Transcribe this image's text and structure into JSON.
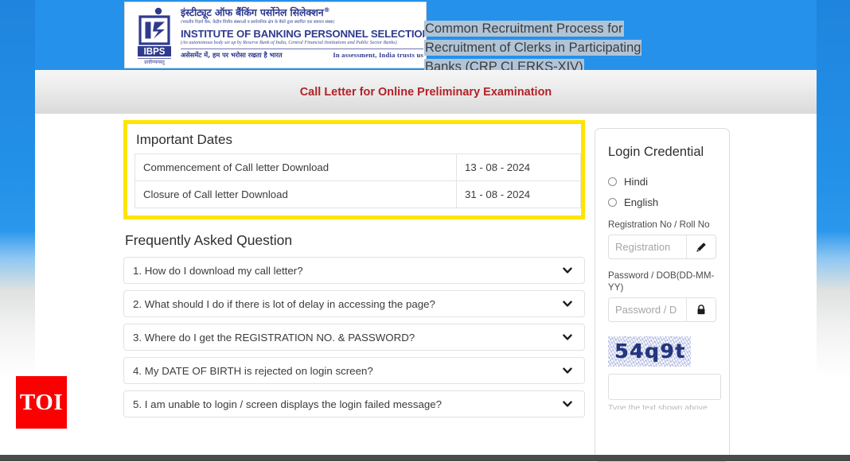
{
  "logo": {
    "hindi_title": "इंस्टीट्यूट ऑफ बैंकिंग पर्सोनेल सिलेक्शन",
    "registered_mark": "®",
    "hindi_subtitle": "(भारतीय रिज़र्व बैंक, केंद्रीय वित्तीय संस्थाओं व सार्वजनिक क्षेत्र के बैंकों द्वारा स्थापित एक स्वायत्त संस्था)",
    "english_title": "INSTITUTE OF BANKING PERSONNEL SELECTION",
    "english_subtitle": "(An autonomous body set up by Reserve Bank of India, Central Financial Institutions and Public Sector Banks)",
    "tagline_hindi": "असेसमेंट में, हम पर भरोसा रखता है भारत",
    "tagline_english": "In assessment, India trusts us",
    "acronym": "IBPS",
    "emblem_sanskrit": "प्रावीण्यमस्तु",
    "brand_color": "#2f3a8f"
  },
  "header": {
    "crp_line1": "Common Recruitment Process for",
    "crp_line2": "Recruitment of Clerks in Participating",
    "crp_line3": "Banks (CRP CLERKS-XIV)",
    "selection_color": "#b0c4d8",
    "band_color": "#2591ea"
  },
  "subheader": {
    "title": "Call Letter for Online Preliminary Examination",
    "title_color": "#b32025"
  },
  "important_dates": {
    "heading": "Important Dates",
    "highlight_color": "#ffe400",
    "rows": [
      {
        "label": "Commencement of Call letter Download",
        "date": "13 - 08 - 2024"
      },
      {
        "label": "Closure of Call letter Download",
        "date": "31 - 08 - 2024"
      }
    ]
  },
  "faq": {
    "heading": "Frequently Asked Question",
    "items": [
      {
        "question": "1. How do I download my call letter?",
        "icon": "chevron-down-icon"
      },
      {
        "question": "2. What should I do if there is lot of delay in accessing the page?",
        "icon": "chevron-down-icon"
      },
      {
        "question": "3. Where do I get the REGISTRATION NO. & PASSWORD?",
        "icon": "chevron-down-icon"
      },
      {
        "question": "4. My DATE OF BIRTH is rejected on login screen?",
        "icon": "chevron-down-icon"
      },
      {
        "question": "5. I am unable to login / screen displays the login failed message?",
        "icon": "chevron-down-icon"
      }
    ]
  },
  "login": {
    "title": "Login Credential",
    "language_options": [
      {
        "label": "Hindi",
        "selected": false
      },
      {
        "label": "English",
        "selected": false
      }
    ],
    "registration": {
      "label": "Registration No / Roll No",
      "placeholder": "Registration",
      "value": "",
      "addon_icon": "pencil-icon"
    },
    "password": {
      "label": "Password / DOB(DD-MM-YY)",
      "placeholder": "Password / D",
      "value": "",
      "addon_icon": "lock-icon"
    },
    "captcha": {
      "text": "54q9t",
      "input_value": "",
      "input_placeholder": "",
      "hint": "Type the text shown above"
    }
  },
  "watermark": {
    "label": "TOI",
    "color": "#fa0000"
  }
}
